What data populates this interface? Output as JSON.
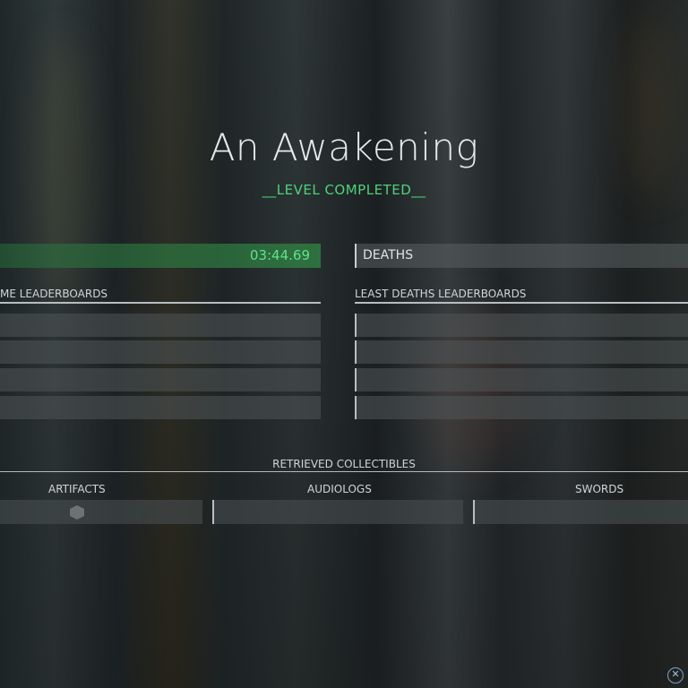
{
  "level": {
    "title": "An Awakening",
    "status": "__LEVEL COMPLETED__"
  },
  "time": {
    "value": "03:44.69",
    "leaderboard_heading": "ME LEADERBOARDS",
    "leaderboard_rows": [
      "",
      "",
      "",
      ""
    ]
  },
  "deaths": {
    "label": "DEATHS",
    "leaderboard_heading": "LEAST DEATHS LEADERBOARDS",
    "leaderboard_rows": [
      "",
      "",
      "",
      ""
    ]
  },
  "collectibles": {
    "heading": "RETRIEVED COLLECTIBLES",
    "categories": [
      {
        "label": "ARTIFACTS",
        "icon": "artifact-gem-icon"
      },
      {
        "label": "AUDIOLOGS"
      },
      {
        "label": "SWORDS"
      }
    ]
  },
  "controls": {
    "close_icon": "close-circle-icon",
    "close_glyph": "✕"
  },
  "colors": {
    "accent_green": "#4fd27a",
    "time_bar": "#2f8c4a"
  }
}
